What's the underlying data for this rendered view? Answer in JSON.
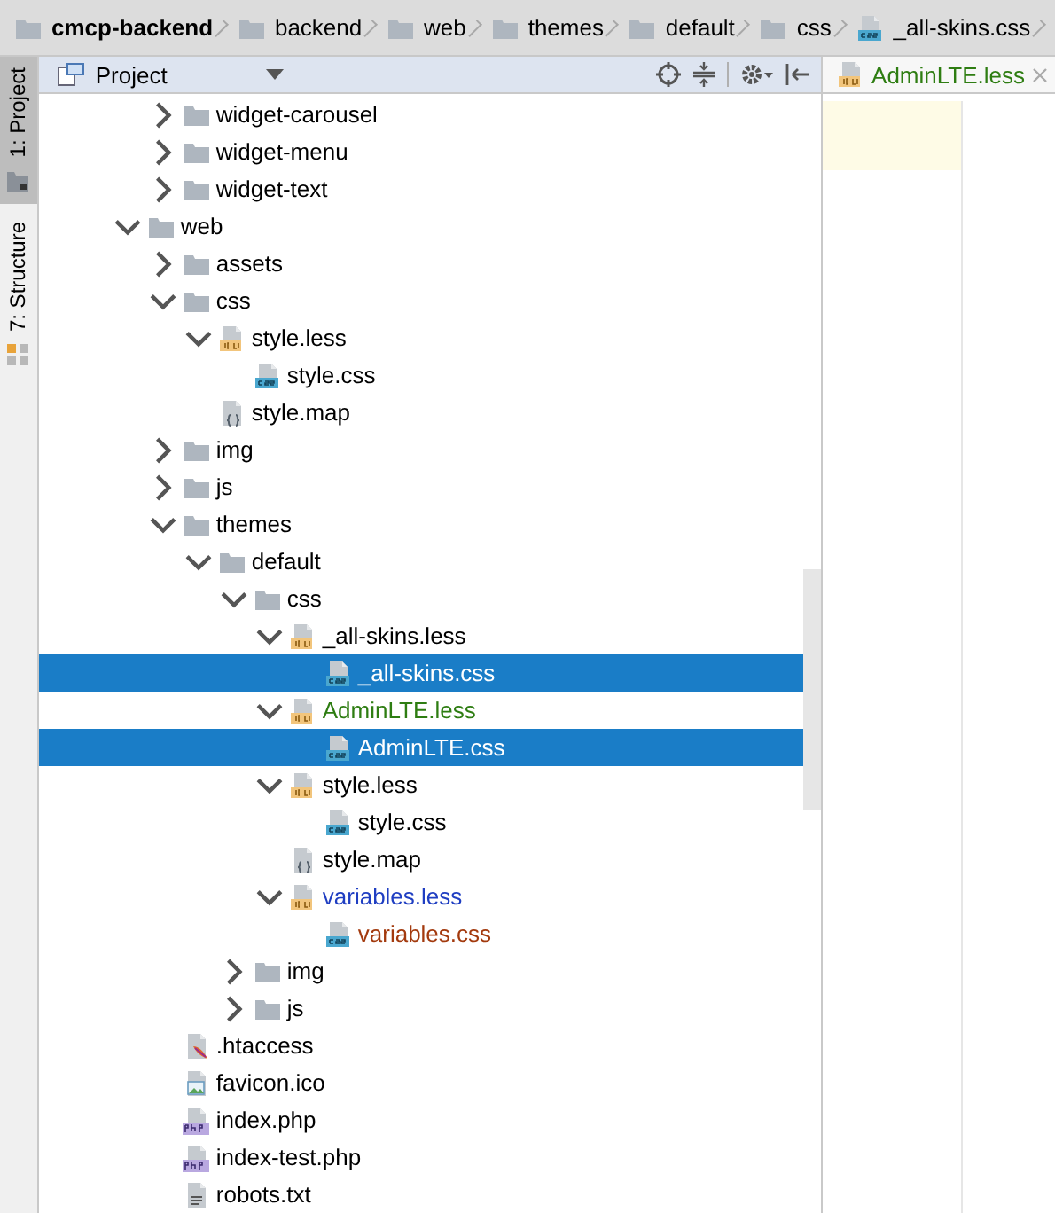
{
  "breadcrumbs": [
    {
      "label": "cmcp-backend",
      "kind": "folder",
      "bold": true
    },
    {
      "label": "backend",
      "kind": "folder",
      "bold": false
    },
    {
      "label": "web",
      "kind": "folder",
      "bold": false
    },
    {
      "label": "themes",
      "kind": "folder",
      "bold": false
    },
    {
      "label": "default",
      "kind": "folder",
      "bold": false
    },
    {
      "label": "css",
      "kind": "folder",
      "bold": false
    },
    {
      "label": "_all-skins.css",
      "kind": "css",
      "bold": false
    }
  ],
  "side_tabs": [
    {
      "label": "1: Project",
      "selected": true
    },
    {
      "label": "7: Structure",
      "selected": false
    }
  ],
  "project_panel": {
    "title": "Project"
  },
  "tree": [
    {
      "children": [
        {
          "name": "widget-carousel",
          "kind": "folder",
          "expanded": false,
          "selected": false,
          "color": "#000000"
        },
        {
          "name": "widget-menu",
          "kind": "folder",
          "expanded": false,
          "selected": false,
          "color": "#000000"
        },
        {
          "name": "widget-text",
          "kind": "folder",
          "expanded": false,
          "selected": false,
          "color": "#000000"
        }
      ]
    },
    {
      "name": "web",
      "kind": "folder",
      "expanded": true,
      "selected": false,
      "color": "#000000",
      "children": [
        {
          "name": "assets",
          "kind": "folder",
          "expanded": false,
          "selected": false,
          "color": "#000000"
        },
        {
          "name": "css",
          "kind": "folder",
          "expanded": true,
          "selected": false,
          "color": "#000000",
          "children": [
            {
              "name": "style.less",
              "kind": "less",
              "expanded": true,
              "selected": false,
              "color": "#000000",
              "children": [
                {
                  "name": "style.css",
                  "kind": "css",
                  "selected": false,
                  "color": "#000000"
                }
              ]
            },
            {
              "name": "style.map",
              "kind": "map",
              "selected": false,
              "color": "#000000"
            }
          ]
        },
        {
          "name": "img",
          "kind": "folder",
          "expanded": false,
          "selected": false,
          "color": "#000000"
        },
        {
          "name": "js",
          "kind": "folder",
          "expanded": false,
          "selected": false,
          "color": "#000000"
        },
        {
          "name": "themes",
          "kind": "folder",
          "expanded": true,
          "selected": false,
          "color": "#000000",
          "children": [
            {
              "name": "default",
              "kind": "folder",
              "expanded": true,
              "selected": false,
              "color": "#000000",
              "children": [
                {
                  "name": "css",
                  "kind": "folder",
                  "expanded": true,
                  "selected": false,
                  "color": "#000000",
                  "children": [
                    {
                      "name": "_all-skins.less",
                      "kind": "less",
                      "expanded": true,
                      "selected": false,
                      "color": "#000000",
                      "children": [
                        {
                          "name": "_all-skins.css",
                          "kind": "css",
                          "selected": true
                        }
                      ]
                    },
                    {
                      "name": "AdminLTE.less",
                      "kind": "less",
                      "expanded": true,
                      "selected": false,
                      "color": "#2e7d12",
                      "children": [
                        {
                          "name": "AdminLTE.css",
                          "kind": "css",
                          "selected": true
                        }
                      ]
                    },
                    {
                      "name": "style.less",
                      "kind": "less",
                      "expanded": true,
                      "selected": false,
                      "color": "#000000",
                      "children": [
                        {
                          "name": "style.css",
                          "kind": "css",
                          "selected": false,
                          "color": "#000000"
                        }
                      ]
                    },
                    {
                      "name": "style.map",
                      "kind": "map",
                      "selected": false,
                      "color": "#000000"
                    },
                    {
                      "name": "variables.less",
                      "kind": "less",
                      "expanded": true,
                      "selected": false,
                      "color": "#1f3ec2",
                      "children": [
                        {
                          "name": "variables.css",
                          "kind": "css",
                          "selected": false,
                          "color": "#a33a0e"
                        }
                      ]
                    }
                  ]
                },
                {
                  "name": "img",
                  "kind": "folder",
                  "expanded": false,
                  "selected": false,
                  "color": "#000000"
                },
                {
                  "name": "js",
                  "kind": "folder",
                  "expanded": false,
                  "selected": false,
                  "color": "#000000"
                }
              ]
            }
          ]
        },
        {
          "name": ".htaccess",
          "kind": "htaccess",
          "selected": false,
          "color": "#000000"
        },
        {
          "name": "favicon.ico",
          "kind": "image",
          "selected": false,
          "color": "#000000"
        },
        {
          "name": "index.php",
          "kind": "php",
          "selected": false,
          "color": "#000000"
        },
        {
          "name": "index-test.php",
          "kind": "php",
          "selected": false,
          "color": "#000000"
        },
        {
          "name": "robots.txt",
          "kind": "text",
          "selected": false,
          "color": "#000000"
        }
      ]
    }
  ],
  "editor_tab": {
    "label": "AdminLTE.less",
    "kind": "less",
    "color": "#2e7d12"
  }
}
